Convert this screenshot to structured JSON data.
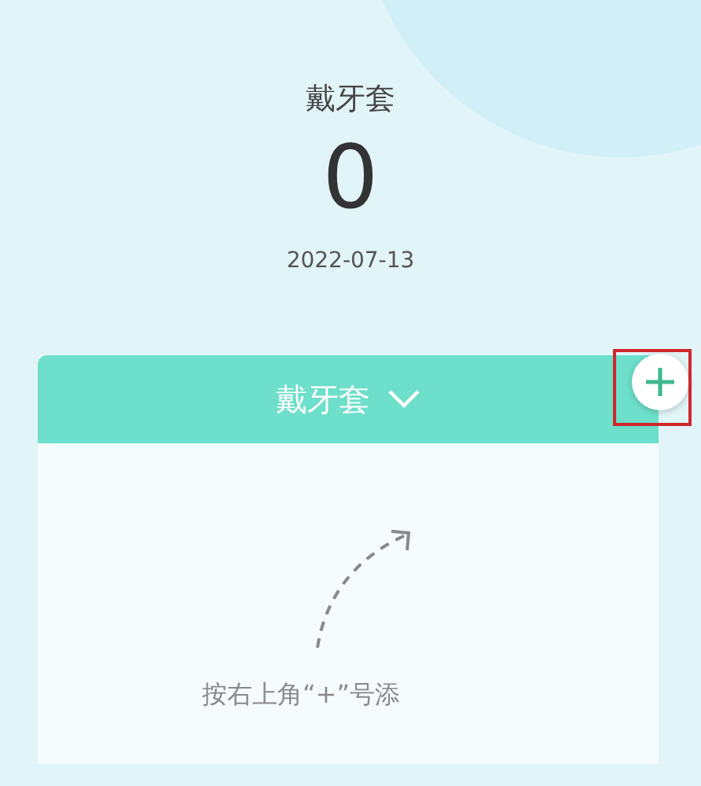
{
  "header": {
    "title": "戴牙套",
    "count": "0",
    "date": "2022-07-13"
  },
  "card": {
    "title": "戴牙套",
    "hint": "按右上角“+”号添"
  },
  "add_button": {
    "highlighted": true
  }
}
